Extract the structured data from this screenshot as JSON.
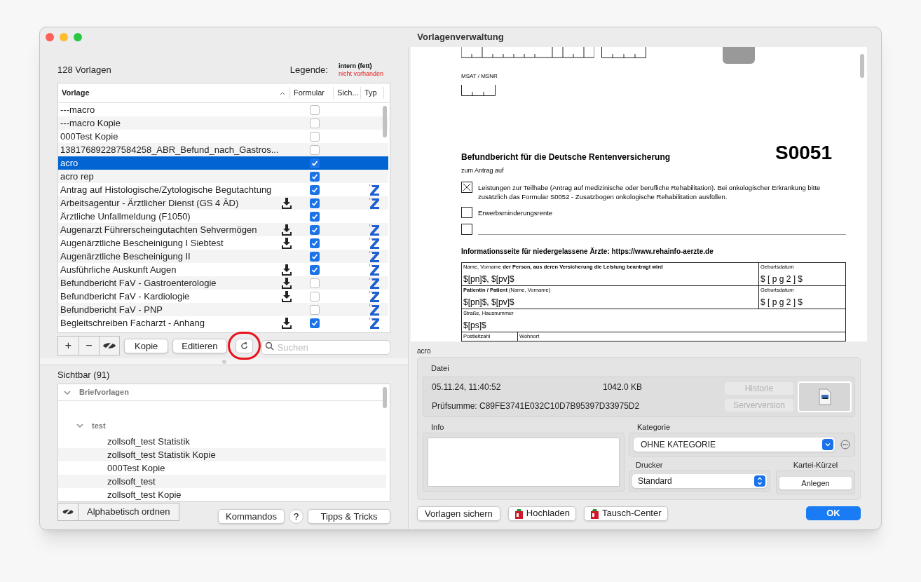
{
  "window": {
    "title": "Vorlagenverwaltung"
  },
  "left": {
    "count": "128 Vorlagen",
    "legend_label": "Legende:",
    "legend_bold": "intern (fett)",
    "legend_missing": "nicht vorhanden",
    "columns": [
      "Vorlage",
      "Formular",
      "Sich...",
      "Typ"
    ],
    "rows": [
      {
        "name": "---macro",
        "download": false,
        "checked": false,
        "typ": false,
        "selected": false
      },
      {
        "name": "---macro Kopie",
        "download": false,
        "checked": false,
        "typ": false,
        "selected": false
      },
      {
        "name": "000Test Kopie",
        "download": false,
        "checked": false,
        "typ": false,
        "selected": false
      },
      {
        "name": "138176892287584258_ABR_Befund_nach_Gastros...",
        "download": false,
        "checked": false,
        "typ": false,
        "selected": false
      },
      {
        "name": "acro",
        "download": false,
        "checked": true,
        "typ": false,
        "selected": true
      },
      {
        "name": "acro rep",
        "download": false,
        "checked": true,
        "typ": false,
        "selected": false
      },
      {
        "name": "Antrag auf Histologische/Zytologische Begutachtung",
        "download": false,
        "checked": true,
        "typ": true,
        "selected": false
      },
      {
        "name": "Arbeitsagentur - Ärztlicher Dienst (GS 4 ÄD)",
        "download": true,
        "checked": true,
        "typ": true,
        "selected": false
      },
      {
        "name": "Ärztliche Unfallmeldung (F1050)",
        "download": false,
        "checked": true,
        "typ": false,
        "selected": false
      },
      {
        "name": "Augenarzt Führerscheingutachten Sehvermögen",
        "download": true,
        "checked": true,
        "typ": true,
        "selected": false
      },
      {
        "name": "Augenärztliche Bescheinigung I Siebtest",
        "download": true,
        "checked": true,
        "typ": true,
        "selected": false
      },
      {
        "name": "Augenärztliche Bescheinigung II",
        "download": false,
        "checked": true,
        "typ": true,
        "selected": false
      },
      {
        "name": "Ausführliche Auskunft Augen",
        "download": true,
        "checked": true,
        "typ": true,
        "selected": false
      },
      {
        "name": "Befundbericht FaV - Gastroenterologie",
        "download": true,
        "checked": false,
        "typ": true,
        "selected": false
      },
      {
        "name": "Befundbericht FaV - Kardiologie",
        "download": true,
        "checked": false,
        "typ": true,
        "selected": false
      },
      {
        "name": "Befundbericht FaV - PNP",
        "download": false,
        "checked": false,
        "typ": true,
        "selected": false
      },
      {
        "name": "Begleitschreiben Facharzt - Anhang",
        "download": true,
        "checked": true,
        "typ": true,
        "selected": false
      }
    ],
    "toolbar": {
      "plus": "+",
      "minus": "−",
      "copy": "Kopie",
      "edit": "Editieren",
      "search_placeholder": "Suchen"
    },
    "visible_title": "Sichtbar (91)",
    "tree": [
      {
        "label": "Briefvorlagen",
        "expanded": true,
        "children": [
          {
            "label": "test",
            "expanded": true,
            "children": [
              {
                "label": "zollsoft_test Statistik"
              },
              {
                "label": "zollsoft_test Statistik Kopie"
              },
              {
                "label": "000Test Kopie"
              },
              {
                "label": "zollsoft_test"
              },
              {
                "label": "zollsoft_test Kopie"
              }
            ]
          }
        ]
      }
    ],
    "sort_button": "Alphabetisch ordnen",
    "commands": "Kommandos",
    "help": "?",
    "tips": "Tipps & Tricks"
  },
  "preview": {
    "msat": "MSAT / MSNR",
    "title": "Befundbericht für die Deutsche Rentenversicherung",
    "code": "S0051",
    "subtitle": "zum Antrag auf",
    "options": [
      {
        "label": "Leistungen zur Teilhabe (Antrag auf medizinische oder berufliche Rehabilitation). Bei onkologischer Erkrankung bitte zusätzlich das Formular S0052 - Zusatzbogen onkologische Rehabilitation ausfüllen.",
        "checked": true
      },
      {
        "label": "Erwerbsminderungsrente",
        "checked": false
      },
      {
        "checked": false
      }
    ],
    "info": "Informationsseite für niedergelassene Ärzte: https://www.rehainfo-aerzte.de",
    "fields": [
      {
        "label": "Name, Vorname **der Person, aus deren Versicherung die Leistung beantragt wird**",
        "value": "$[pn]$, $[pv]$",
        "date_label": "Geburtsdatum",
        "date_value": "$ [ p g 2 ] $"
      },
      {
        "label": "**Patientin / Patient** (Name, Vorname)",
        "value": "$[pn]$, $[pv]$",
        "date_label": "Geburtsdatum",
        "date_value": "$ [ p g 2 ] $"
      },
      {
        "label": "Straße, Hausnummer",
        "value": "$[ps]$"
      }
    ],
    "last_labels": [
      "Postleitzahl",
      "Wohnort"
    ]
  },
  "details": {
    "name": "acro",
    "file_label": "Datei",
    "date": "05.11.24, 11:40:52",
    "size": "1042.0 KB",
    "checksum": "Prüfsumme: C89FE3741E032C10D7B95397D33975D2",
    "history": "Historie",
    "server": "Serverversion",
    "info_label": "Info",
    "category_label": "Kategorie",
    "category": "OHNE KATEGORIE",
    "printer_label": "Drucker",
    "printer": "Standard",
    "short_label": "Kartei-Kürzel",
    "short_button": "Anlegen"
  },
  "footer": {
    "save": "Vorlagen sichern",
    "upload": "Hochladen",
    "exchange": "Tausch-Center",
    "ok": "OK"
  }
}
